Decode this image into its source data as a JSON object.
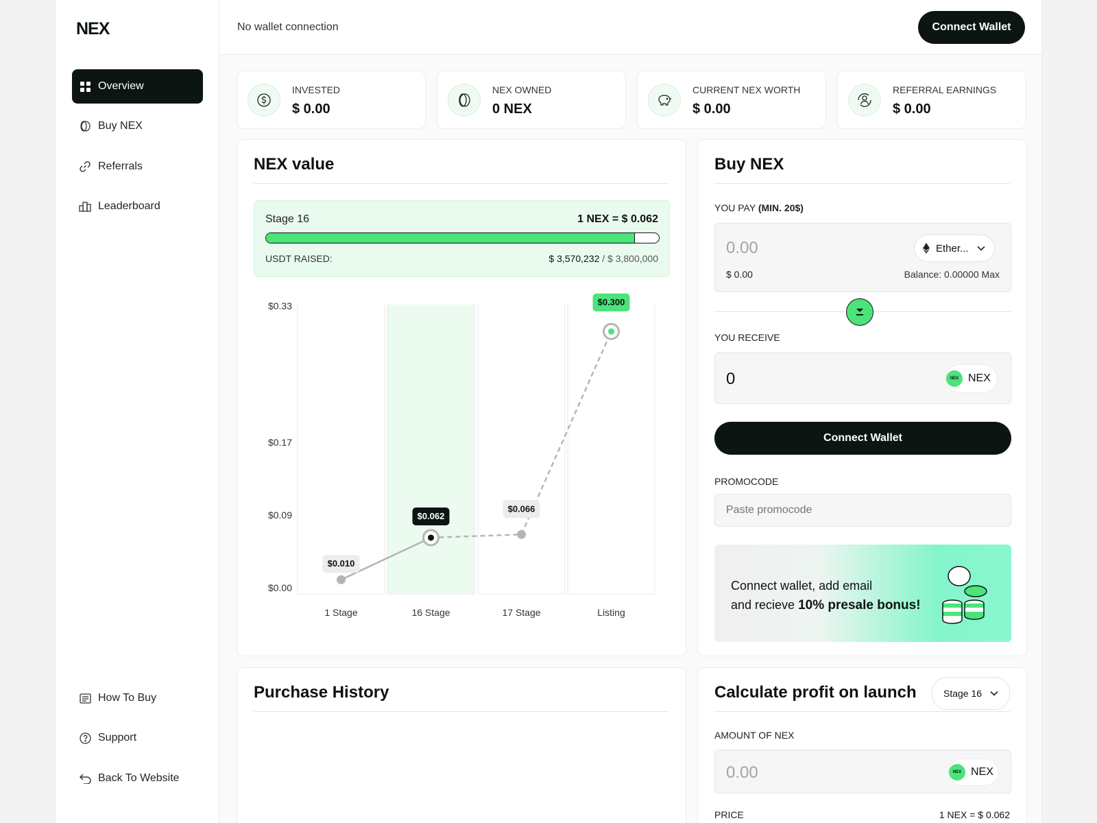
{
  "brand": {
    "logo": "NEX"
  },
  "sidebar": {
    "items": [
      {
        "label": "Overview",
        "icon": "grid-icon"
      },
      {
        "label": "Buy NEX",
        "icon": "coin-icon"
      },
      {
        "label": "Referrals",
        "icon": "link-icon"
      },
      {
        "label": "Leaderboard",
        "icon": "podium-icon"
      }
    ],
    "bottom": [
      {
        "label": "How To Buy",
        "icon": "document-icon"
      },
      {
        "label": "Support",
        "icon": "help-icon"
      },
      {
        "label": "Back To Website",
        "icon": "return-icon"
      }
    ]
  },
  "topbar": {
    "status": "No wallet connection",
    "connect": "Connect Wallet"
  },
  "stats": [
    {
      "label": "INVESTED",
      "value": "$ 0.00",
      "icon": "dollar-icon"
    },
    {
      "label": "NEX OWNED",
      "value": "0 NEX",
      "icon": "coin-icon"
    },
    {
      "label": "CURRENT NEX WORTH",
      "value": "$ 0.00",
      "icon": "piggy-bank-icon"
    },
    {
      "label": "REFERRAL EARNINGS",
      "value": "$ 0.00",
      "icon": "referral-icon"
    }
  ],
  "nex_value": {
    "title": "NEX value",
    "stage": "Stage 16",
    "rate": "1 NEX = $ 0.062",
    "progress": 0.9395,
    "raised_label": "USDT RAISED:",
    "raised": "$ 3,570,232",
    "goal": "/ $ 3,800,000"
  },
  "chart_data": {
    "type": "line",
    "categories": [
      "1 Stage",
      "16 Stage",
      "17 Stage",
      "Listing"
    ],
    "values": [
      0.01,
      0.062,
      0.066,
      0.3
    ],
    "point_labels": [
      "$0.010",
      "$0.062",
      "$0.066",
      "$0.300"
    ],
    "y_ticks": [
      {
        "value": 0.0,
        "label": "$0.00"
      },
      {
        "value": 0.09,
        "label": "$0.09"
      },
      {
        "value": 0.17,
        "label": "$0.17"
      },
      {
        "value": 0.33,
        "label": "$0.33"
      }
    ],
    "ylim": [
      0,
      0.33
    ],
    "highlight_category": "16 Stage",
    "colors": {
      "accent": "#4be37a",
      "line": "#b5b5b5",
      "current": "#0d1512"
    }
  },
  "buy": {
    "title": "Buy NEX",
    "pay_label": "YOU PAY",
    "pay_min": "(MIN. 20$)",
    "pay_placeholder": "0.00",
    "pay_usd": "$ 0.00",
    "currency": "Ether...",
    "balance": "Balance: 0.00000",
    "max": "Max",
    "receive_label": "YOU RECEIVE",
    "receive_value": "0",
    "receive_token": "NEX",
    "connect": "Connect Wallet",
    "promo_label": "PROMOCODE",
    "promo_placeholder": "Paste promocode",
    "bonus_line1": "Connect wallet, add email",
    "bonus_line2": "and recieve",
    "bonus_strong": "10% presale bonus!"
  },
  "history": {
    "title": "Purchase History"
  },
  "calc": {
    "title": "Calculate profit on launch",
    "stage": "Stage 16",
    "amount_label": "AMOUNT OF NEX",
    "amount_placeholder": "0.00",
    "token": "NEX",
    "price_label": "PRICE",
    "price_value": "1 NEX = $ 0.062"
  }
}
